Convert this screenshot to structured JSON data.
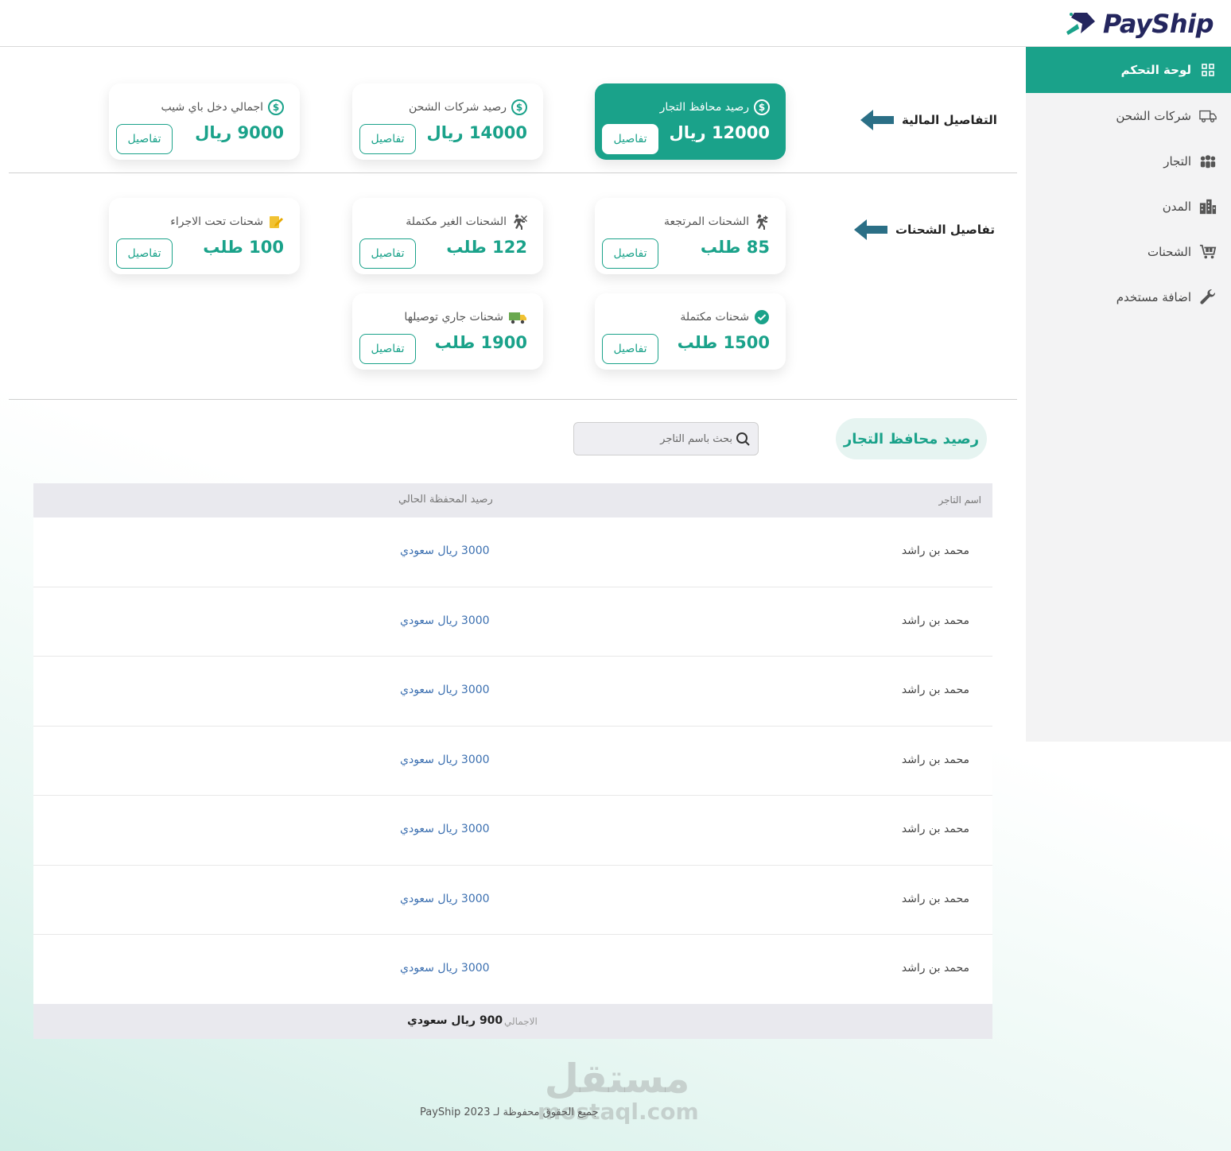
{
  "brand": {
    "name": "PayShip"
  },
  "sidebar": {
    "items": [
      {
        "label": "لوحة التحكم",
        "icon": "grid-icon",
        "active": true
      },
      {
        "label": "شركات الشحن",
        "icon": "truck-icon"
      },
      {
        "label": "التجار",
        "icon": "group-icon"
      },
      {
        "label": "المدن",
        "icon": "city-icon"
      },
      {
        "label": "الشحنات",
        "icon": "cart-icon"
      },
      {
        "label": "اضافة مستخدم",
        "icon": "wrench-icon"
      }
    ]
  },
  "financial": {
    "section_label": "التفاصيل المالية",
    "cards": [
      {
        "title": "رصيد محافظ التجار",
        "value": "12000 ريال",
        "button": "تفاصيل",
        "icon": "dollar-icon"
      },
      {
        "title": "رصيد شركات الشحن",
        "value": "14000 ريال",
        "button": "تفاصيل",
        "icon": "dollar-icon"
      },
      {
        "title": "اجمالي دخل باي شيب",
        "value": "9000 ريال",
        "button": "تفاصيل",
        "icon": "dollar-icon"
      }
    ]
  },
  "shipments": {
    "section_label": "تفاصيل الشحنات",
    "cards": [
      {
        "title": "الشحنات المرتجعة",
        "value": "85 طلب",
        "button": "تفاصيل",
        "icon": "return-icon"
      },
      {
        "title": "الشحنات الغير مكتملة",
        "value": "122 طلب",
        "button": "تفاصيل",
        "icon": "incomplete-icon"
      },
      {
        "title": "شحنات تحت الاجراء",
        "value": "100 طلب",
        "button": "تفاصيل",
        "icon": "edit-icon"
      },
      {
        "title": "شحنات مكتملة",
        "value": "1500 طلب",
        "button": "تفاصيل",
        "icon": "check-icon"
      },
      {
        "title": "شحنات جاري توصيلها",
        "value": "1900 طلب",
        "button": "تفاصيل",
        "icon": "delivery-truck-icon"
      }
    ]
  },
  "wallets": {
    "heading": "رصيد محافظ التجار",
    "search_placeholder": "بحث باسم التاجر",
    "columns": [
      "اسم التاجر",
      "رصيد المحفظة الحالي"
    ],
    "rows": [
      {
        "name": "محمد بن راشد",
        "balance": "3000 ريال سعودي"
      },
      {
        "name": "محمد بن راشد",
        "balance": "3000 ريال سعودي"
      },
      {
        "name": "محمد بن راشد",
        "balance": "3000 ريال سعودي"
      },
      {
        "name": "محمد بن راشد",
        "balance": "3000 ريال سعودي"
      },
      {
        "name": "محمد بن راشد",
        "balance": "3000 ريال سعودي"
      },
      {
        "name": "محمد بن راشد",
        "balance": "3000 ريال سعودي"
      },
      {
        "name": "محمد بن راشد",
        "balance": "3000 ريال سعودي"
      }
    ],
    "total_label": "الاجمالي",
    "total_value": "900 ريال سعودي"
  },
  "footer": {
    "text": "جميع الحقوق محفوظة لـ PayShip 2023"
  },
  "watermark": {
    "line1": "مستقل",
    "line2": "mostaql.com"
  },
  "colors": {
    "accent": "#1aa28a",
    "brand_dark": "#24265e",
    "arrow": "#2b6f86",
    "link": "#3b6fb0"
  }
}
